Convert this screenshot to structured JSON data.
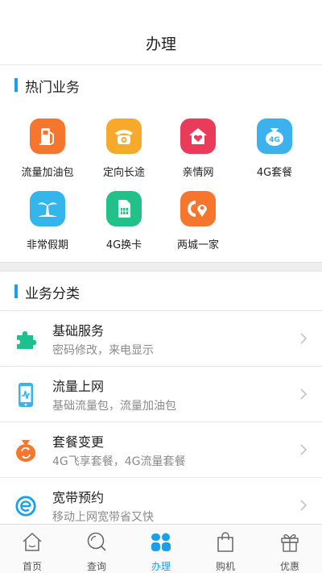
{
  "header": {
    "title": "办理"
  },
  "hot": {
    "title": "热门业务",
    "items": [
      {
        "label": "流量加油包",
        "icon": "fuel-pump-icon",
        "color": "#f5762c"
      },
      {
        "label": "定向长途",
        "icon": "telephone-icon",
        "color": "#f7a92b"
      },
      {
        "label": "亲情网",
        "icon": "heart-house-icon",
        "color": "#eb3b5a"
      },
      {
        "label": "4G套餐",
        "icon": "4g-bag-icon",
        "color": "#3bb2ee"
      },
      {
        "label": "非常假期",
        "icon": "palm-tree-icon",
        "color": "#34b6ec"
      },
      {
        "label": "4G换卡",
        "icon": "sim-card-icon",
        "color": "#22c189"
      },
      {
        "label": "两城一家",
        "icon": "two-cities-icon",
        "color": "#f5762c"
      }
    ]
  },
  "categories": {
    "title": "业务分类",
    "items": [
      {
        "title": "基础服务",
        "subtitle": "密码修改，来电显示",
        "icon": "puzzle-icon",
        "color": "#1fbf8f"
      },
      {
        "title": "流量上网",
        "subtitle": "基础流量包，流量加油包",
        "icon": "phone-data-icon",
        "color": "#3bb2ee"
      },
      {
        "title": "套餐变更",
        "subtitle": "4G飞享套餐，4G流量套餐",
        "icon": "money-bag-icon",
        "color": "#f5762c"
      },
      {
        "title": "宽带预约",
        "subtitle": "移动上网宽带省又快",
        "icon": "broadband-e-icon",
        "color": "#1aa0e8"
      }
    ]
  },
  "tabbar": {
    "active_color": "#1aa0e8",
    "tabs": [
      {
        "label": "首页",
        "icon": "home-icon"
      },
      {
        "label": "查询",
        "icon": "search-icon"
      },
      {
        "label": "办理",
        "icon": "apps-icon"
      },
      {
        "label": "购机",
        "icon": "shopping-bag-icon"
      },
      {
        "label": "优惠",
        "icon": "gift-icon"
      }
    ]
  }
}
